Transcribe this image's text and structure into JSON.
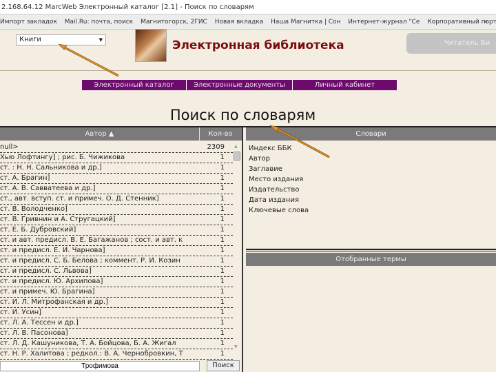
{
  "browser": {
    "title": "2.168.64.12 MarcWeb Электронный каталог [2.1] - Поиск по словарям",
    "bookmarks": [
      "Импорт закладок",
      "Mail.Ru: почта, поиск",
      "Магнитогорск, 2ГИС",
      "Новая вкладка",
      "Наша Магнитка | Сон",
      "Интернет-журнал \"Се",
      "Корпоративный порт"
    ],
    "more": "»"
  },
  "header": {
    "collection_select": "Книги",
    "site_title": "Электронная библиотека",
    "reader_button": "Читатель Би"
  },
  "nav": [
    "Электронный каталог",
    "Электронные документы",
    "Личный кабинет"
  ],
  "page_title": "Поиск по словарям",
  "table": {
    "col_author": "Автор ▲",
    "col_count": "Кол-во",
    "rows": [
      {
        "a": "null>",
        "n": "2309"
      },
      {
        "a": "Хью Лофтингу] ; рис. Б. Чижикова",
        "n": "1"
      },
      {
        "a": "ст. : Н. Н. Сальникова и др.]",
        "n": "1"
      },
      {
        "a": "ст. А. Брагин]",
        "n": "1"
      },
      {
        "a": "ст. А. В. Савватеева и др.]",
        "n": "1"
      },
      {
        "a": "ст., авт. вступ. ст. и примеч. О. Д. Стенник]",
        "n": "1"
      },
      {
        "a": "ст. В. Володченко]",
        "n": "1"
      },
      {
        "a": "ст. В. Гривнин и А. Стругацкий]",
        "n": "1"
      },
      {
        "a": "ст. Е. Б. Дубровский]",
        "n": "1"
      },
      {
        "a": "ст. и авт. предисл. В. Е. Багажанов ; сост. и авт. к",
        "n": "1"
      },
      {
        "a": "ст. и предисл. Е. И. Чарнова]",
        "n": "1"
      },
      {
        "a": "ст. и предисл. С. Б. Белова ; коммент. Р. И. Козин",
        "n": "1"
      },
      {
        "a": "ст. и предисл. С. Львова]",
        "n": "1"
      },
      {
        "a": "ст. и предисл. Ю. Архипова]",
        "n": "1"
      },
      {
        "a": "ст. и примеч. Ю. Брагина]",
        "n": "1"
      },
      {
        "a": "ст. И. Л. Митрофанская и др.]",
        "n": "1"
      },
      {
        "a": "ст. И. Усин]",
        "n": "1"
      },
      {
        "a": "ст. Л. А. Тессен и др.]",
        "n": "1"
      },
      {
        "a": "ст. Л. В. Пасонова]",
        "n": "1"
      },
      {
        "a": "ст. Л. Д. Кашуникова, Т. А. Бойцова, Б. А. Жигал",
        "n": "1"
      },
      {
        "a": "ст. Н. Р. Халитова ; редкол.: В. А. Чернобровкин, Т",
        "n": "1"
      }
    ]
  },
  "search": {
    "value": "Трофимова",
    "button": "Поиск"
  },
  "dictionaries": {
    "title": "Словари",
    "items": [
      "Индекс ББК",
      "Автор",
      "Заглавие",
      "Место издания",
      "Издательство",
      "Дата издания",
      "Ключевые слова"
    ]
  },
  "selected": {
    "title": "Отобранные термы"
  },
  "colors": {
    "nav": "#6d0a6d",
    "title": "#7a0d0d",
    "header_gray": "#7a7a7a",
    "bg": "#f4ede1",
    "arrow": "#e0902a"
  }
}
